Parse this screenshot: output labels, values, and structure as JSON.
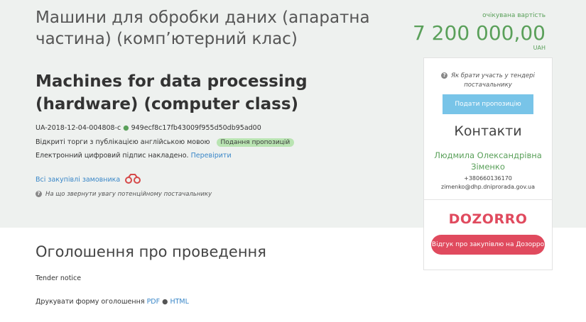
{
  "tender": {
    "title_ua": "Машини для обробки даних (апаратна частина) (комп’ютерний клас)",
    "title_en": "Machines for data processing (hardware) (computer class)",
    "id": "UA-2018-12-04-004808-c",
    "hash_separator": "●",
    "hash": "949ecf8c17fb43009f955d50db95ad00",
    "procedure": "Відкриті торги з публікацією англійською мовою",
    "status_badge": "Подання пропозицій",
    "signature_text": "Електронний цифровий підпис накладено.",
    "signature_link": "Перевірити",
    "all_purchases_link": "Всі закупівлі замовника",
    "hint_text": "На що звернути увагу потенційному постачальнику"
  },
  "expected_value": {
    "label": "очікувана вартість",
    "amount": "7 200 000,00",
    "currency": "UAH"
  },
  "sidebar": {
    "question": "Як брати участь у тендері постачальнику",
    "submit_label": "Подати пропозицію",
    "contacts_title": "Контакти",
    "contact_name": "Людмила Олександрівна Зіменко",
    "contact_phone": "+380660136170",
    "contact_email": "zimenko@dhp.dniprorada.gov.ua",
    "dozorro_logo": "DOZORRO",
    "dozorro_button": "Відгук про закупівлю на Дозорро"
  },
  "announcement": {
    "heading": "Оголошення про проведення",
    "notice": "Tender notice",
    "print_label": "Друкувати форму оголошення",
    "pdf": "PDF",
    "separator": "●",
    "html": "HTML"
  },
  "colors": {
    "accent_green": "#5aa05a",
    "link_blue": "#3a87c8",
    "dozorro_red": "#e04a5e",
    "submit_blue": "#78c4e8"
  },
  "icons": [
    "question-icon",
    "binoculars-icon"
  ]
}
